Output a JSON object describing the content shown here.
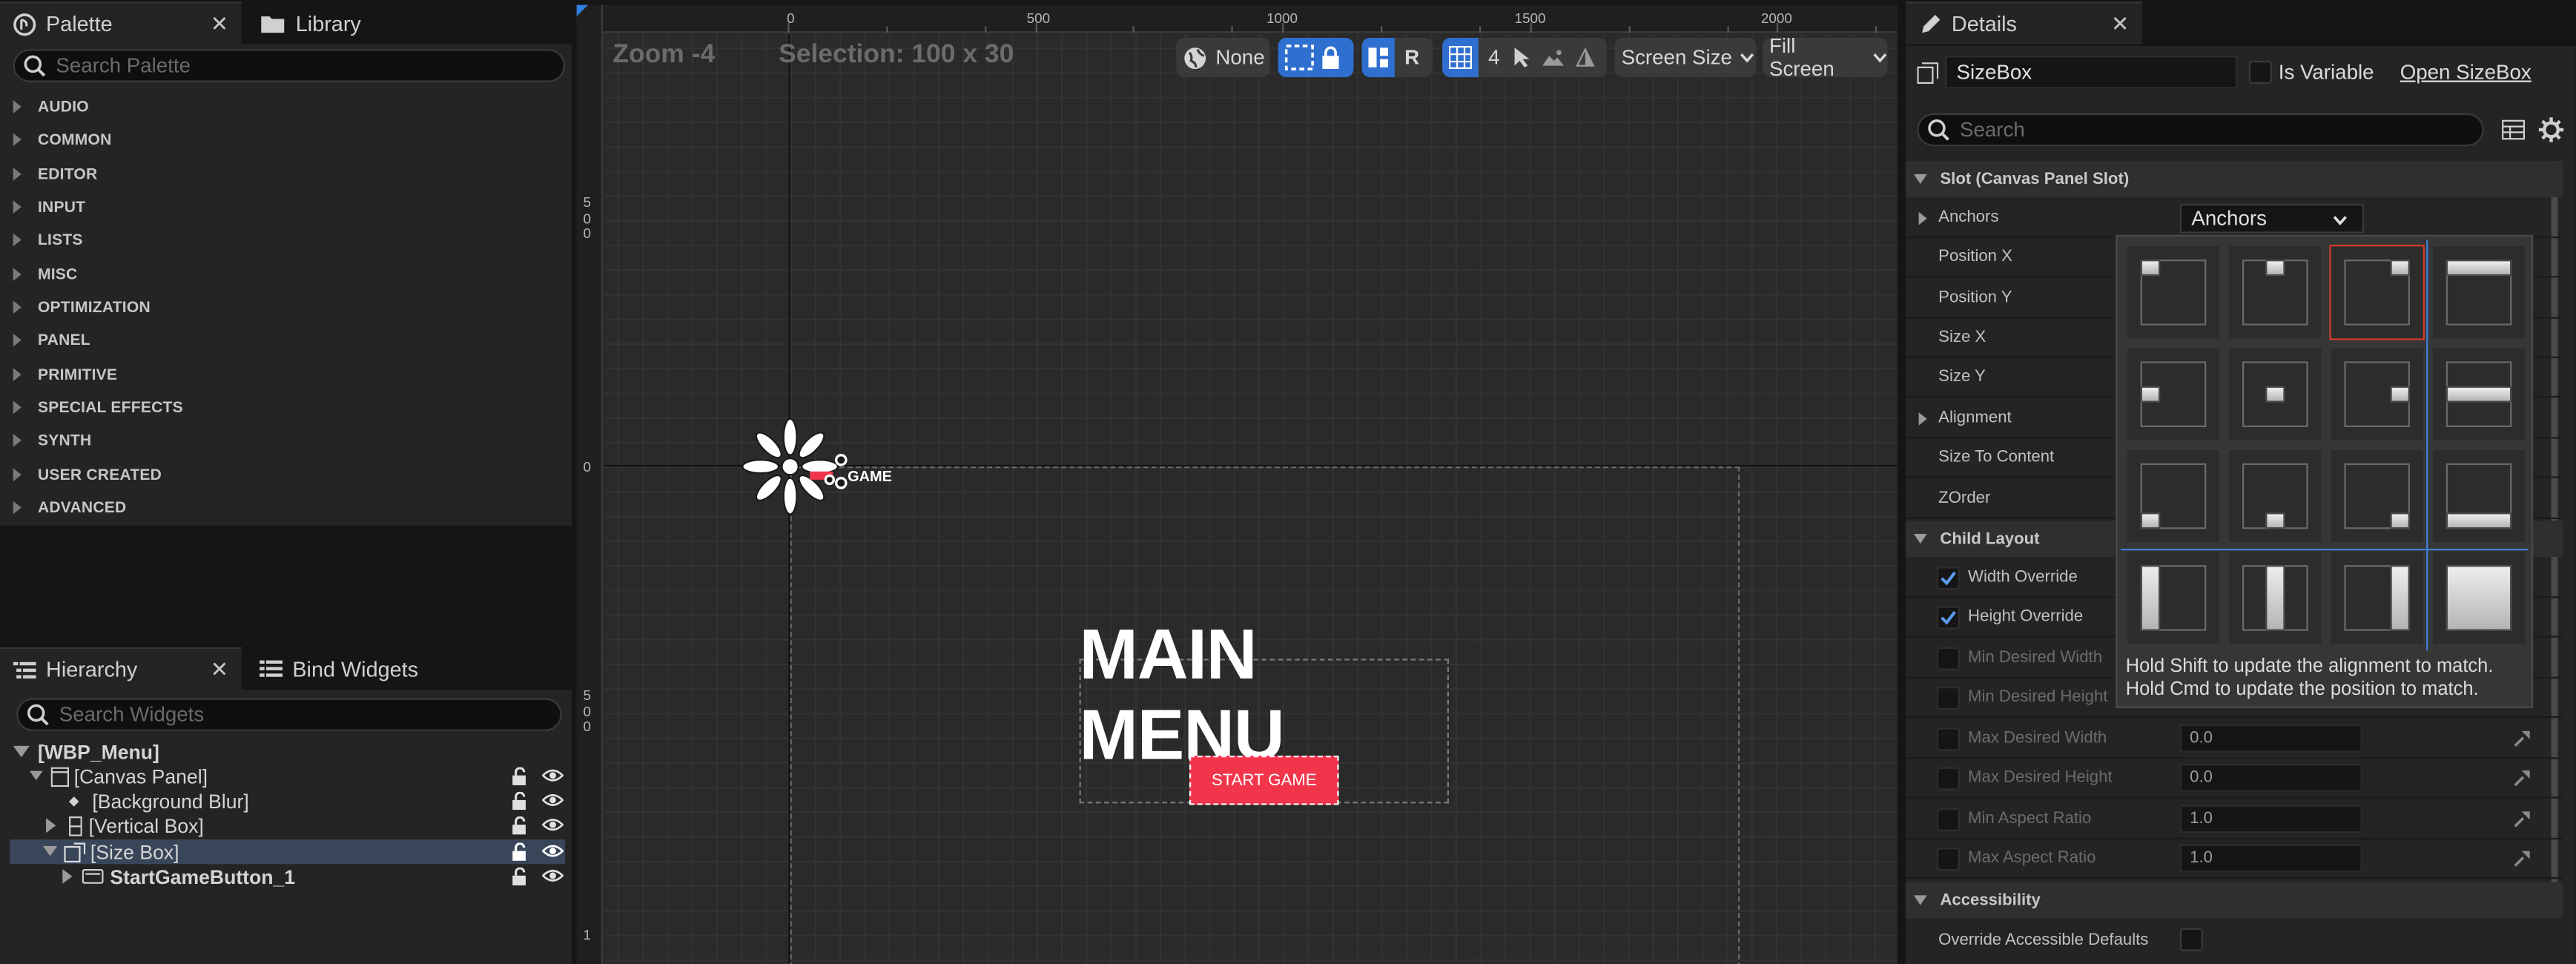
{
  "palette": {
    "tab_label": "Palette",
    "library_tab_label": "Library",
    "search_placeholder": "Search Palette",
    "categories": [
      "AUDIO",
      "COMMON",
      "EDITOR",
      "INPUT",
      "LISTS",
      "MISC",
      "OPTIMIZATION",
      "PANEL",
      "PRIMITIVE",
      "SPECIAL EFFECTS",
      "SYNTH",
      "USER CREATED",
      "ADVANCED"
    ]
  },
  "hierarchy": {
    "tab_label": "Hierarchy",
    "bind_tab_label": "Bind Widgets",
    "search_placeholder": "Search Widgets",
    "items": [
      {
        "label": "[WBP_Menu]"
      },
      {
        "label": "[Canvas Panel]"
      },
      {
        "label": "[Background Blur]"
      },
      {
        "label": "[Vertical Box]"
      },
      {
        "label": "[Size Box]"
      },
      {
        "label": "StartGameButton_1"
      }
    ]
  },
  "viewport": {
    "zoom_label": "Zoom -4",
    "selection_label": "Selection: 100 x 30",
    "ruler_x": [
      "0",
      "500",
      "1000",
      "1500",
      "2000"
    ],
    "ruler_y": [
      "500",
      "0",
      "500",
      "1"
    ],
    "toolbar": {
      "none_label": "None",
      "r_label": "R",
      "grid_value": "4",
      "screen_size_label": "Screen Size",
      "fill_screen_label": "Fill Screen"
    },
    "canvas": {
      "title": "MAIN MENU",
      "button_label": "START GAME",
      "small_label": "GAME",
      "accent": "#f1364c"
    }
  },
  "details": {
    "tab_label": "Details",
    "name_value": "SizeBox",
    "is_variable_label": "Is Variable",
    "open_link": "Open SizeBox",
    "search_placeholder": "Search",
    "sections": {
      "slot": "Slot (Canvas Panel Slot)",
      "child_layout": "Child Layout",
      "accessibility": "Accessibility"
    },
    "slot_rows": {
      "anchors": "Anchors",
      "anchors_value": "Anchors",
      "position_x": "Position X",
      "position_y": "Position Y",
      "size_x": "Size X",
      "size_y": "Size Y",
      "alignment": "Alignment",
      "size_to_content": "Size To Content",
      "zorder": "ZOrder"
    },
    "child_rows": {
      "width_override": "Width Override",
      "height_override": "Height Override",
      "min_desired_width": "Min Desired Width",
      "min_desired_height": "Min Desired Height",
      "max_desired_width": "Max Desired Width",
      "max_desired_width_value": "0.0",
      "max_desired_height": "Max Desired Height",
      "max_desired_height_value": "0.0",
      "min_aspect_ratio": "Min Aspect Ratio",
      "min_aspect_ratio_value": "1.0",
      "max_aspect_ratio": "Max Aspect Ratio",
      "max_aspect_ratio_value": "1.0"
    },
    "access_rows": {
      "override_accessible": "Override Accessible Defaults"
    }
  },
  "anchor_popup": {
    "hint_shift": "Hold Shift to update the alignment to match.",
    "hint_cmd": "Hold Cmd to update the position to match.",
    "selected_color": "#d83a2a"
  },
  "icons": [
    "ue-logo-icon",
    "folder-icon",
    "close-icon",
    "search-icon",
    "hierarchy-icon",
    "bind-widgets-icon",
    "lock-icon",
    "eye-icon",
    "globe-icon",
    "marquee-icon",
    "grid-icon",
    "pen-icon",
    "table-view-icon",
    "gear-icon",
    "reset-arrow-icon",
    "chevron-down-icon",
    "checkmark-icon"
  ]
}
